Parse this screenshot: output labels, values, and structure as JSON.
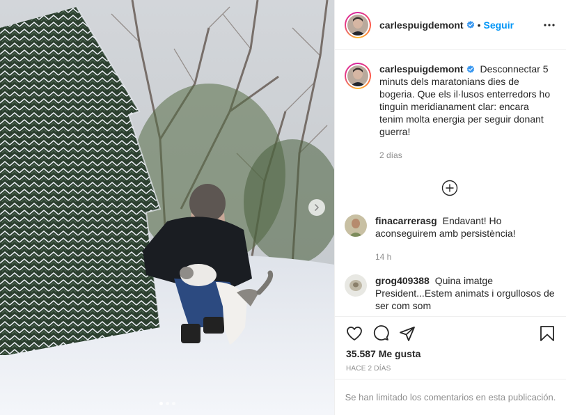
{
  "header": {
    "username": "carlespuigdemont",
    "separator": "•",
    "follow_label": "Seguir"
  },
  "caption": {
    "username": "carlespuigdemont",
    "text": "Desconnectar 5 minuts dels maratonians dies de bogeria. Que els il·lusos enterredors ho tinguin meridianament clar: encara tenim molta energia per seguir donant guerra!",
    "time": "2 días"
  },
  "comments": [
    {
      "username": "finacarrerasg",
      "text": "Endavant! Ho aconseguirem amb persistència!",
      "time": "14 h"
    },
    {
      "username": "grog409388",
      "text": "Quina imatge President...Estem animats i orgullosos de ser com som",
      "time": ""
    }
  ],
  "engagement": {
    "likes": "35.587 Me gusta",
    "date": "HACE 2 DÍAS"
  },
  "footer": {
    "limited_comments": "Se han limitado los comentarios en esta publicación."
  },
  "carousel": {
    "total": 3,
    "active": 1
  },
  "icons": [
    "verified-icon",
    "more-icon",
    "add-comments-icon",
    "heart-icon",
    "comment-icon",
    "share-icon",
    "bookmark-icon",
    "next-arrow-icon"
  ],
  "colors": {
    "accent": "#0095f6",
    "verified": "#3897f0",
    "text": "#262626",
    "muted": "#8e8e8e"
  }
}
